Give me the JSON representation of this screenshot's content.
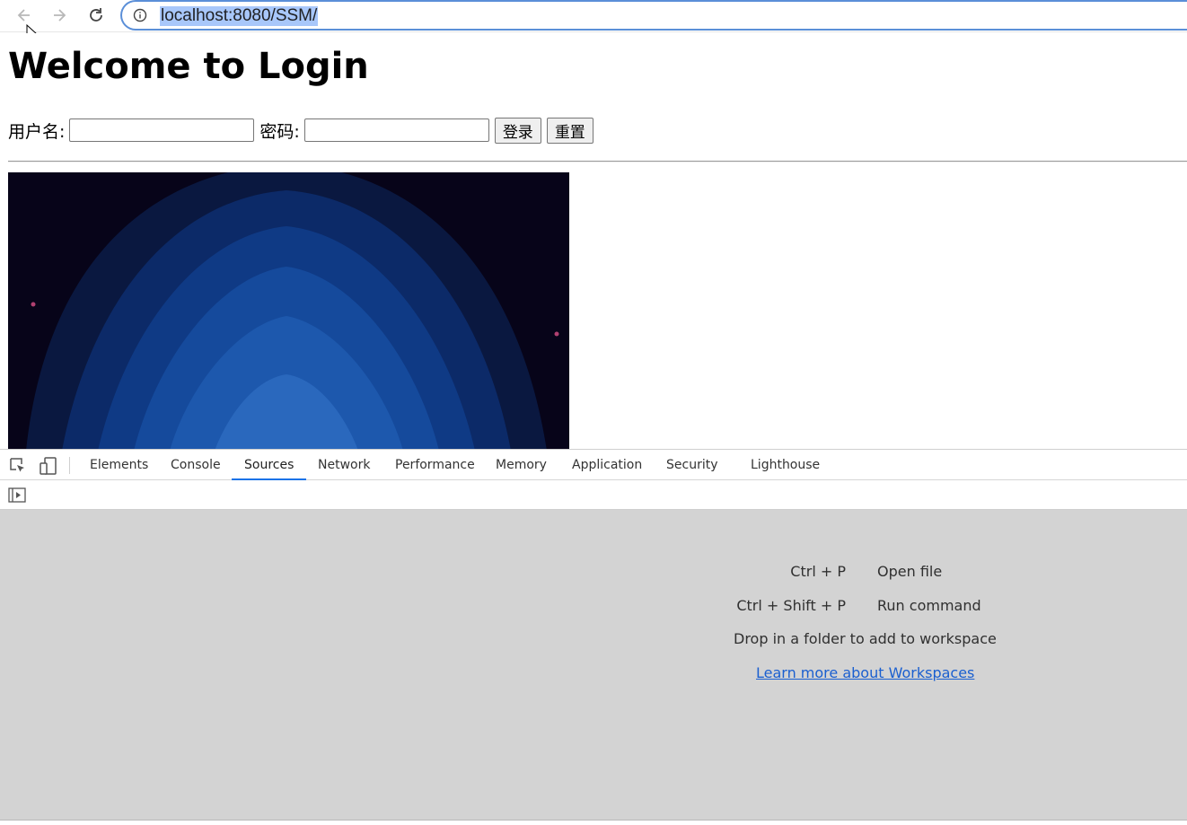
{
  "browser": {
    "url": "localhost:8080/SSM/"
  },
  "page": {
    "title": "Welcome to Login",
    "username_label": "用户名:",
    "password_label": "密码:",
    "username_value": "",
    "password_value": "",
    "login_button": "登录",
    "reset_button": "重置"
  },
  "devtools": {
    "tabs": [
      {
        "label": "Elements",
        "active": false
      },
      {
        "label": "Console",
        "active": false
      },
      {
        "label": "Sources",
        "active": true
      },
      {
        "label": "Network",
        "active": false
      },
      {
        "label": "Performance",
        "active": false
      },
      {
        "label": "Memory",
        "active": false
      },
      {
        "label": "Application",
        "active": false
      },
      {
        "label": "Security",
        "active": false
      },
      {
        "label": "Lighthouse",
        "active": false
      }
    ],
    "shortcuts": [
      {
        "key": "Ctrl + P",
        "action": "Open file"
      },
      {
        "key": "Ctrl + Shift + P",
        "action": "Run command"
      }
    ],
    "drop_hint": "Drop in a folder to add to workspace",
    "learn_more": "Learn more about Workspaces"
  },
  "colors": {
    "accent": "#1a73e8",
    "url_highlight": "#a8c7fa",
    "panel_bg": "#d3d3d3",
    "link": "#1a5fd0"
  }
}
